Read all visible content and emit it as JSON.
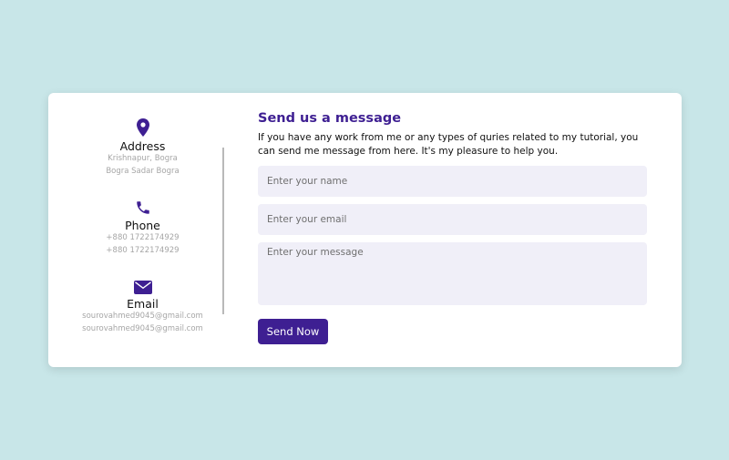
{
  "contact_info": {
    "address": {
      "icon": "map-marker-icon",
      "heading": "Address",
      "lines": [
        "Krishnapur, Bogra",
        "Bogra Sadar Bogra"
      ]
    },
    "phone": {
      "icon": "phone-icon",
      "heading": "Phone",
      "lines": [
        "+880 1722174929",
        "+880 1722174929"
      ]
    },
    "email": {
      "icon": "envelope-icon",
      "heading": "Email",
      "lines": [
        "sourovahmed9045@gmail.com",
        "sourovahmed9045@gmail.com"
      ]
    }
  },
  "form": {
    "title": "Send us a message",
    "description": "If you have any work from me or any types of quries related to my tutorial, you can send me message from here. It's my pleasure to help you.",
    "name_placeholder": "Enter your name",
    "email_placeholder": "Enter your email",
    "message_placeholder": "Enter your message",
    "submit_label": "Send Now"
  },
  "colors": {
    "background": "#c8e6e8",
    "accent": "#3e1f92",
    "field_bg": "#f0eff8"
  }
}
